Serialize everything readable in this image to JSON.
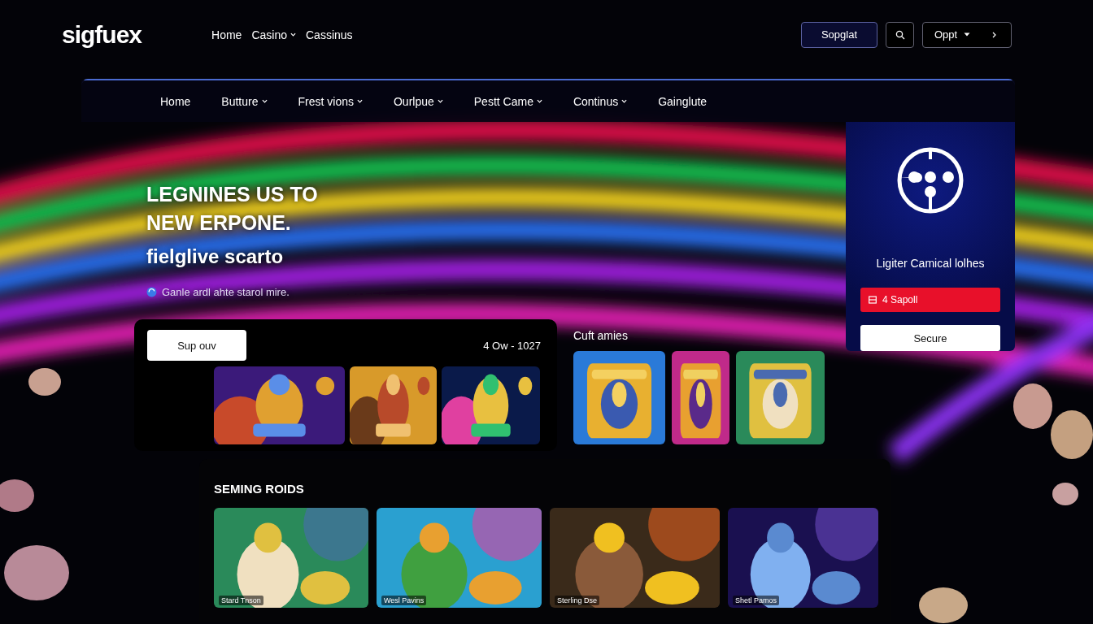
{
  "header": {
    "logo": "sigfuex",
    "nav": [
      {
        "label": "Home",
        "dropdown": false
      },
      {
        "label": "Casino",
        "dropdown": true
      },
      {
        "label": "Cassinus",
        "dropdown": false
      }
    ],
    "signup_button": "Sopglat",
    "menu_label": "Oppt"
  },
  "main_nav": [
    {
      "label": "Home",
      "dropdown": false
    },
    {
      "label": "Butture",
      "dropdown": true
    },
    {
      "label": "Frest vions",
      "dropdown": true
    },
    {
      "label": "Ourlpue",
      "dropdown": true
    },
    {
      "label": "Pestt Came",
      "dropdown": true
    },
    {
      "label": "Continus",
      "dropdown": true
    },
    {
      "label": "Gainglute",
      "dropdown": false
    }
  ],
  "hero": {
    "title_lines": [
      "LEGNINES US TO",
      "NEW ERPONE."
    ],
    "subtitle": "fielglive scarto",
    "note": "Ganle ardl ahte starol mire."
  },
  "promo": {
    "button": "Sup ouv",
    "date": "4 Ow - 1027"
  },
  "featured": {
    "title": "Cuft amies"
  },
  "side_card": {
    "title": "Ligiter Camical lolhes",
    "primary_button": "4 Sapoll",
    "secondary_button": "Secure"
  },
  "section": {
    "title": "SEMING ROIDS",
    "tiles": [
      {
        "kind": "picture",
        "caption": "Stard Tnson"
      },
      {
        "kind": "picture",
        "caption": "Wesl Pavins"
      },
      {
        "kind": "picture",
        "caption": "Sterling Dse"
      },
      {
        "kind": "picture",
        "caption": "Shetl Pamos"
      }
    ]
  }
}
